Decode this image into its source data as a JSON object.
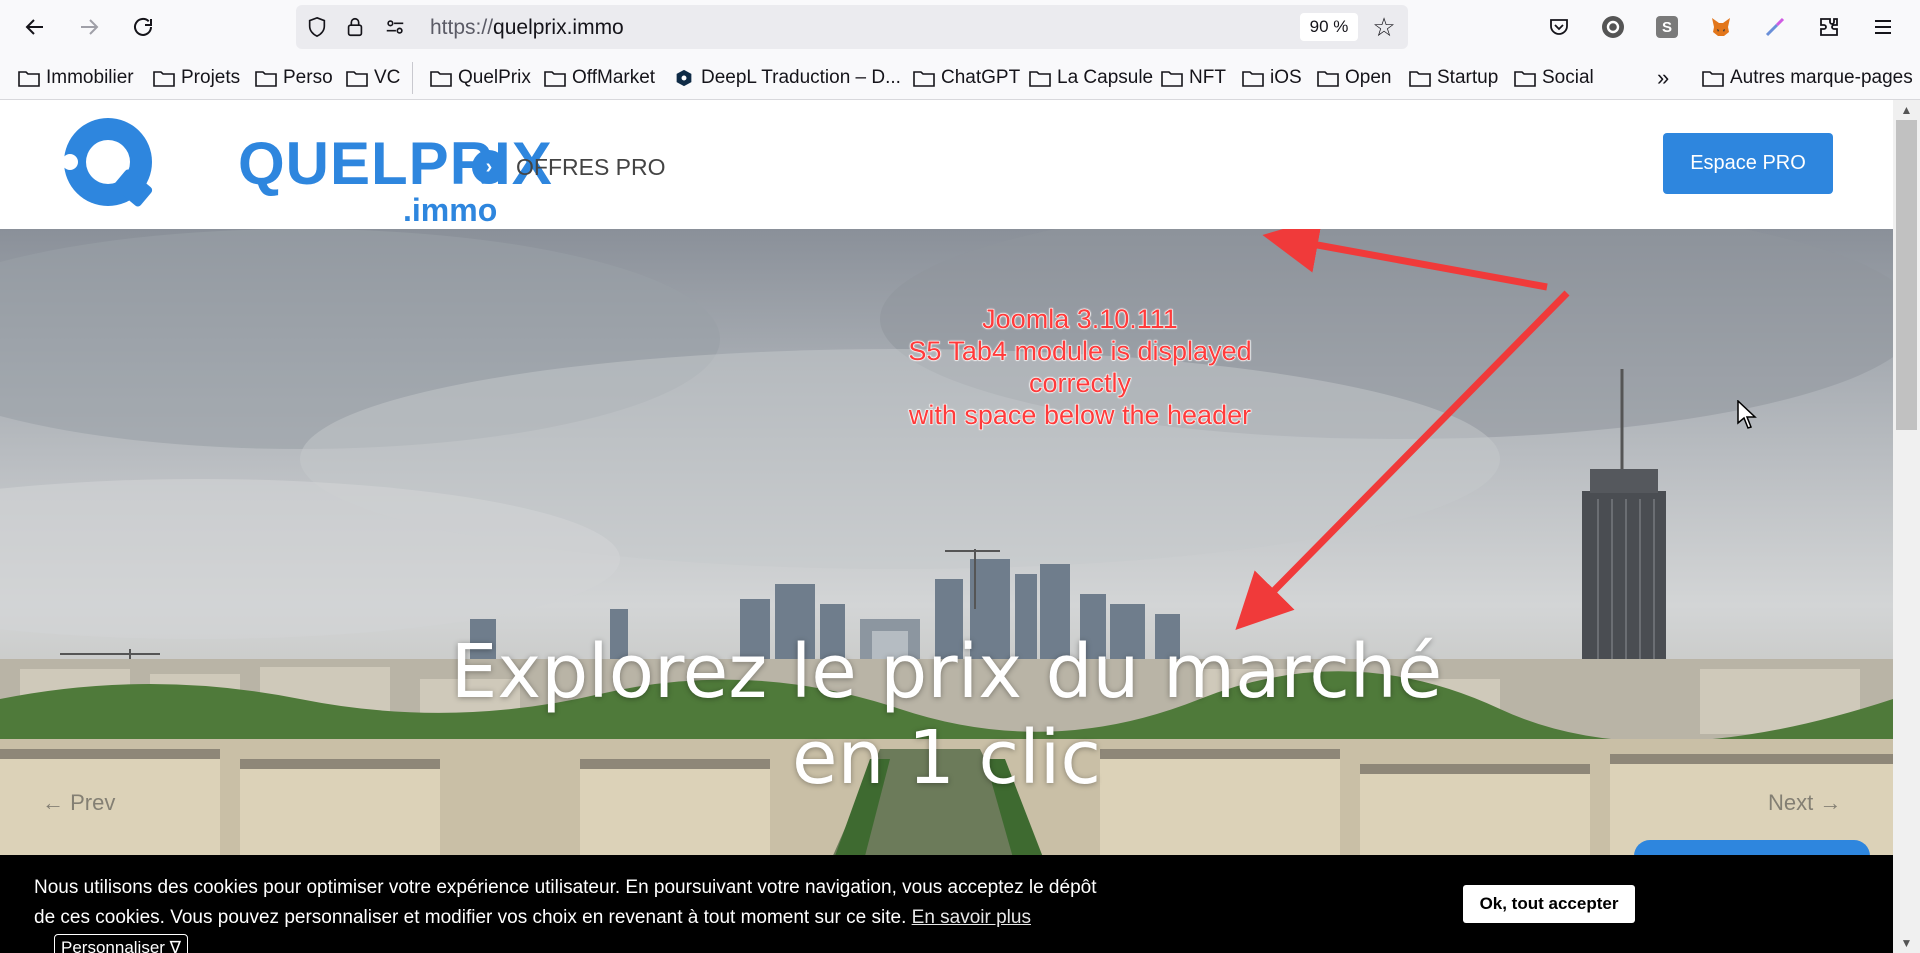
{
  "browser": {
    "url_protocol": "https://",
    "url_host": "quelprix.immo",
    "zoom": "90 %"
  },
  "bookmarks": [
    {
      "label": "Immobilier",
      "type": "folder"
    },
    {
      "label": "Projets",
      "type": "folder"
    },
    {
      "label": "Perso",
      "type": "folder"
    },
    {
      "label": "VC",
      "type": "folder"
    },
    {
      "label": "QuelPrix",
      "type": "folder"
    },
    {
      "label": "OffMarket",
      "type": "folder"
    },
    {
      "label": "DeepL Traduction – D...",
      "type": "site"
    },
    {
      "label": "ChatGPT",
      "type": "folder"
    },
    {
      "label": "La Capsule",
      "type": "folder"
    },
    {
      "label": "NFT",
      "type": "folder"
    },
    {
      "label": "iOS",
      "type": "folder"
    },
    {
      "label": "Open",
      "type": "folder"
    },
    {
      "label": "Startup",
      "type": "folder"
    },
    {
      "label": "Social",
      "type": "folder"
    },
    {
      "label": "Autres marque-pages",
      "type": "folder"
    }
  ],
  "site": {
    "logo_main": "QUELPRIX",
    "logo_sub": ".immo",
    "offres_label": "OFFRES PRO",
    "espace_pro_label": "Espace PRO",
    "brand_color": "#2e86de"
  },
  "hero": {
    "title_line1": "Explorez le prix du marché",
    "title_line2": "en 1 clic",
    "prev_label": "← Prev",
    "next_label": "Next →"
  },
  "annotation": {
    "line1": "Joomla 3.10.111",
    "line2": "S5 Tab4 module is displayed",
    "line3": "correctly",
    "line4": "with space below the header",
    "color": "#ff3b3b"
  },
  "cookie": {
    "text": "Nous utilisons des cookies pour optimiser votre expérience utilisateur. En poursuivant votre navigation, vous acceptez le dépôt de ces cookies. Vous pouvez personnaliser et modifier vos choix en revenant à tout moment sur ce site.",
    "learn_more": "En savoir plus",
    "customize": "Personnaliser ∇",
    "accept": "Ok, tout accepter"
  }
}
